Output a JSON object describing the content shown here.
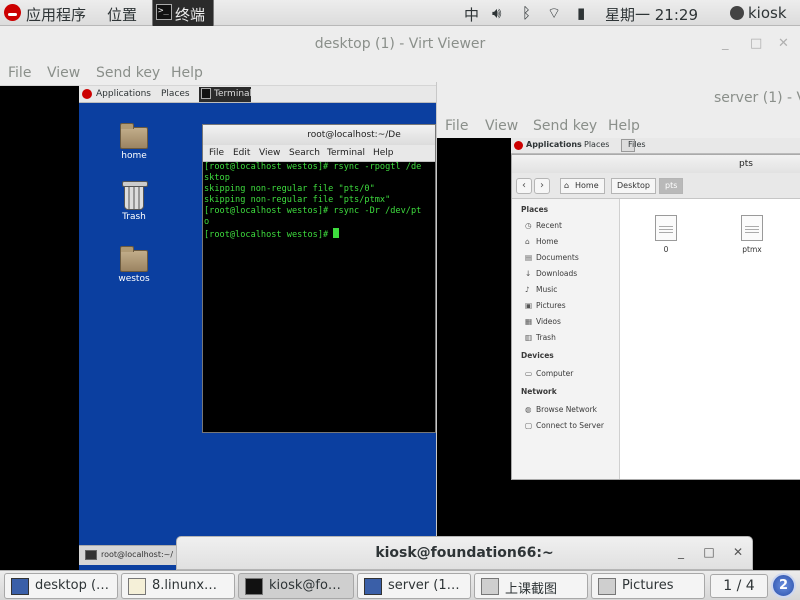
{
  "host_topbar": {
    "applications": "应用程序",
    "places": "位置",
    "terminal_tab": "终端",
    "input_method": "中",
    "clock": "星期一 21:29",
    "user": "kiosk"
  },
  "virt_viewer": {
    "title": "desktop (1) - Virt Viewer",
    "menu": [
      "File",
      "View",
      "Send key",
      "Help"
    ]
  },
  "guest_desktop": {
    "topbar": {
      "applications": "Applications",
      "places": "Places",
      "terminal": "Terminal"
    },
    "icons": [
      "home",
      "Trash",
      "westos"
    ],
    "taskbar_item": "root@localhost:~/"
  },
  "guest_terminal": {
    "title": "root@localhost:~/De",
    "menu": [
      "File",
      "Edit",
      "View",
      "Search",
      "Terminal",
      "Help"
    ],
    "lines": [
      "[root@localhost westos]# rsync -rpogtl /de",
      "sktop",
      "skipping non-regular file \"pts/0\"",
      "skipping non-regular file \"pts/ptmx\"",
      "[root@localhost westos]# rsync -Dr /dev/pt",
      "o",
      "[root@localhost westos]# "
    ]
  },
  "server_viewer": {
    "title": "server (1) - V",
    "menu": [
      "File",
      "View",
      "Send key",
      "Help"
    ],
    "guest_topbar": {
      "applications": "Applications",
      "places": "Places",
      "files": "Files"
    }
  },
  "file_manager": {
    "title": "pts",
    "breadcrumbs": [
      "Home",
      "Desktop",
      "pts"
    ],
    "sidebar": {
      "places_header": "Places",
      "places": [
        {
          "icon": "◷",
          "label": "Recent"
        },
        {
          "icon": "⌂",
          "label": "Home"
        },
        {
          "icon": "▤",
          "label": "Documents"
        },
        {
          "icon": "↓",
          "label": "Downloads"
        },
        {
          "icon": "♪",
          "label": "Music"
        },
        {
          "icon": "▣",
          "label": "Pictures"
        },
        {
          "icon": "▦",
          "label": "Videos"
        },
        {
          "icon": "▥",
          "label": "Trash"
        }
      ],
      "devices_header": "Devices",
      "devices": [
        {
          "icon": "▭",
          "label": "Computer"
        }
      ],
      "network_header": "Network",
      "network": [
        {
          "icon": "◍",
          "label": "Browse Network"
        },
        {
          "icon": "▢",
          "label": "Connect to Server"
        }
      ]
    },
    "files": [
      "0",
      "ptmx"
    ]
  },
  "host_terminal_window": {
    "title": "kiosk@foundation66:~",
    "buttons": {
      "minimize": "_",
      "maximize": "□",
      "close": "✕"
    }
  },
  "taskbar": {
    "items": [
      {
        "label": "desktop (…"
      },
      {
        "label": "8.linunx…"
      },
      {
        "label": "kiosk@fo…"
      },
      {
        "label": "server (1…"
      },
      {
        "label": "上课截图"
      },
      {
        "label": "Pictures"
      }
    ],
    "pager": "1 / 4",
    "notification_count": "2"
  }
}
